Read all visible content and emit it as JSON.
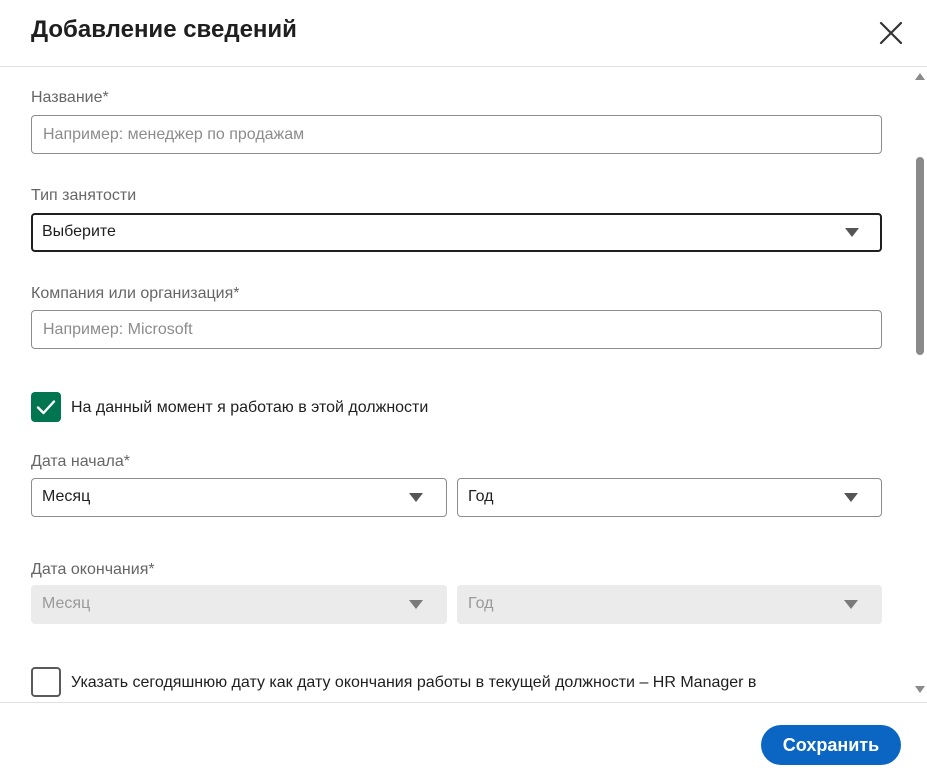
{
  "dialog": {
    "title": "Добавление сведений",
    "close_icon": "close-icon"
  },
  "form": {
    "title_field": {
      "label": "Название*",
      "placeholder": "Например: менеджер по продажам",
      "value": ""
    },
    "employment_type": {
      "label": "Тип занятости",
      "value": "Выберите"
    },
    "company": {
      "label": "Компания или организация*",
      "placeholder": "Например: Microsoft",
      "value": ""
    },
    "currently_working": {
      "label": "На данный момент я работаю в этой должности",
      "checked": true
    },
    "start_date": {
      "label": "Дата начала*",
      "month": "Месяц",
      "year": "Год"
    },
    "end_date": {
      "label": "Дата окончания*",
      "month": "Месяц",
      "year": "Год",
      "disabled": true
    },
    "end_today": {
      "label": "Указать сегодяшнюю дату как дату окончания работы в текущей должности – HR Manager в",
      "checked": false
    }
  },
  "footer": {
    "save_label": "Сохранить"
  },
  "colors": {
    "accent": "#0a66c2",
    "checkbox_checked": "#01754f",
    "disabled_bg": "#ebebeb"
  }
}
